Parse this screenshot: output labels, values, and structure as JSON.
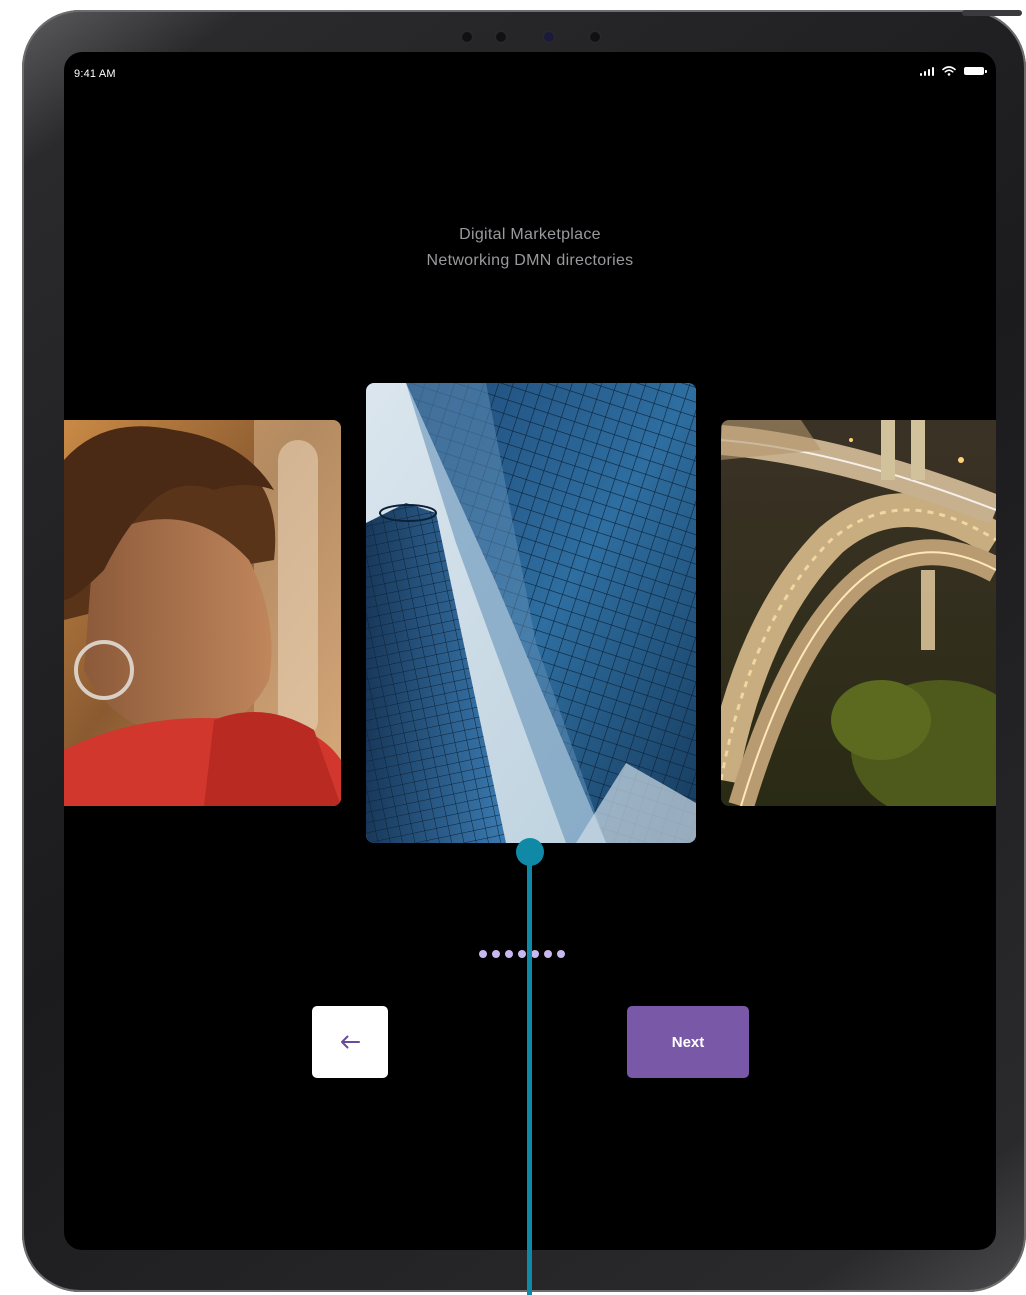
{
  "status_bar": {
    "time": "9:41 AM",
    "icons": [
      "signal-icon",
      "wifi-icon",
      "battery-icon"
    ]
  },
  "headline": {
    "line1": "Digital Marketplace",
    "line2": "Networking DMN directories"
  },
  "carousel": {
    "cards": [
      {
        "name": "portrait-photo",
        "subject": "woman-looking-out-car-window"
      },
      {
        "name": "skyscraper-photo",
        "subject": "glass-skyscrapers-looking-up"
      },
      {
        "name": "highway-photo",
        "subject": "highway-interchange-at-night"
      }
    ],
    "page_indicator": {
      "count": 7,
      "active_index": 3,
      "color": "#c9b8ee"
    }
  },
  "controls": {
    "back_icon": "arrow-left-icon",
    "next_label": "Next",
    "accent_color": "#7a58a8"
  },
  "annotation": {
    "color": "#1089a6"
  }
}
